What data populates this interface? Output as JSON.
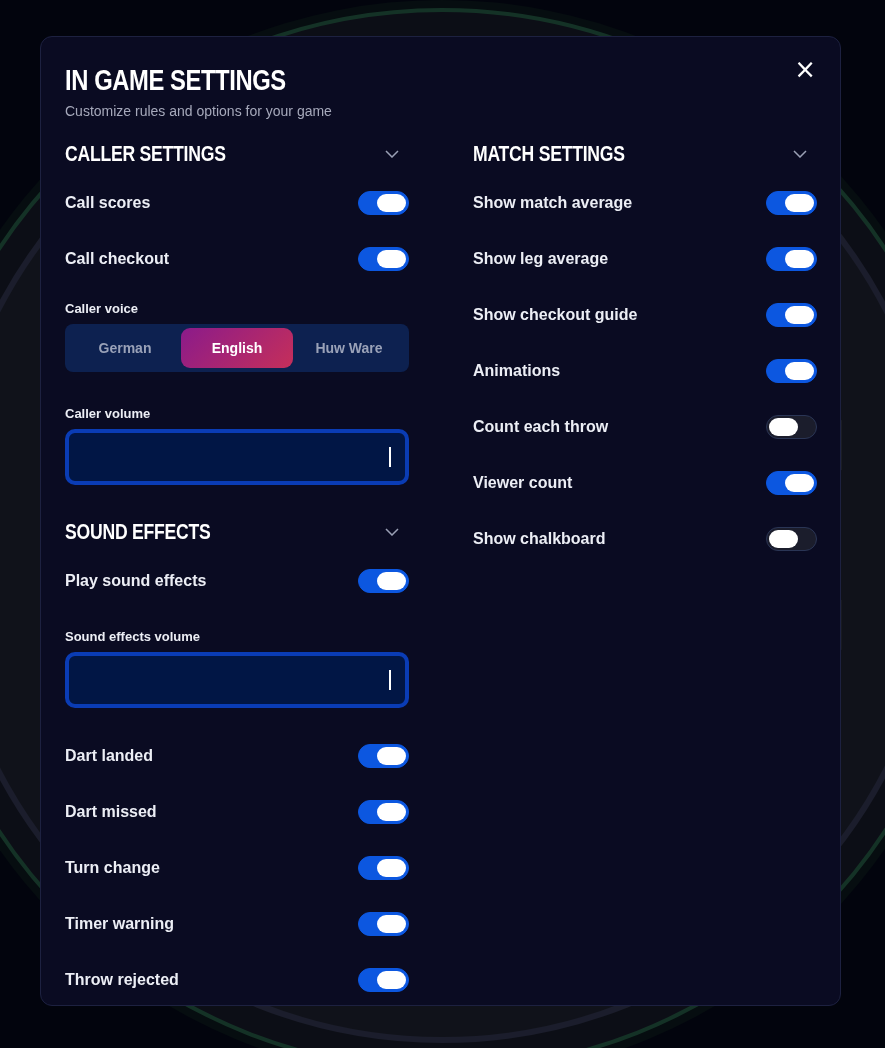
{
  "dialog": {
    "title": "IN GAME SETTINGS",
    "subtitle": "Customize rules and options for your game",
    "close": "×"
  },
  "columns": [
    [
      {
        "title": "CALLER SETTINGS",
        "expanded": true,
        "items": [
          {
            "kind": "toggle",
            "label": "Call scores",
            "on": true
          },
          {
            "kind": "toggle",
            "label": "Call checkout",
            "on": true
          },
          {
            "kind": "segmented",
            "label": "Caller voice",
            "options": [
              {
                "label": "German",
                "selected": false
              },
              {
                "label": "English",
                "selected": true
              },
              {
                "label": "Huw Ware",
                "selected": false
              }
            ]
          },
          {
            "kind": "slider",
            "label": "Caller volume",
            "level": 1
          }
        ]
      },
      {
        "title": "SOUND EFFECTS",
        "expanded": true,
        "items": [
          {
            "kind": "toggle",
            "label": "Play sound effects",
            "on": true
          },
          {
            "kind": "slider",
            "label": "Sound effects volume",
            "level": 1
          },
          {
            "kind": "toggle",
            "label": "Dart landed",
            "on": true
          },
          {
            "kind": "toggle",
            "label": "Dart missed",
            "on": true
          },
          {
            "kind": "toggle",
            "label": "Turn change",
            "on": true
          },
          {
            "kind": "toggle",
            "label": "Timer warning",
            "on": true
          },
          {
            "kind": "toggle",
            "label": "Throw rejected",
            "on": true
          }
        ]
      }
    ],
    [
      {
        "title": "MATCH SETTINGS",
        "expanded": true,
        "items": [
          {
            "kind": "toggle",
            "label": "Show match average",
            "on": true
          },
          {
            "kind": "toggle",
            "label": "Show leg average",
            "on": true
          },
          {
            "kind": "toggle",
            "label": "Show checkout guide",
            "on": true
          },
          {
            "kind": "toggle",
            "label": "Animations",
            "on": true
          },
          {
            "kind": "toggle",
            "label": "Count each throw",
            "on": false
          },
          {
            "kind": "toggle",
            "label": "Viewer count",
            "on": true
          },
          {
            "kind": "toggle",
            "label": "Show chalkboard",
            "on": false
          }
        ]
      }
    ]
  ]
}
